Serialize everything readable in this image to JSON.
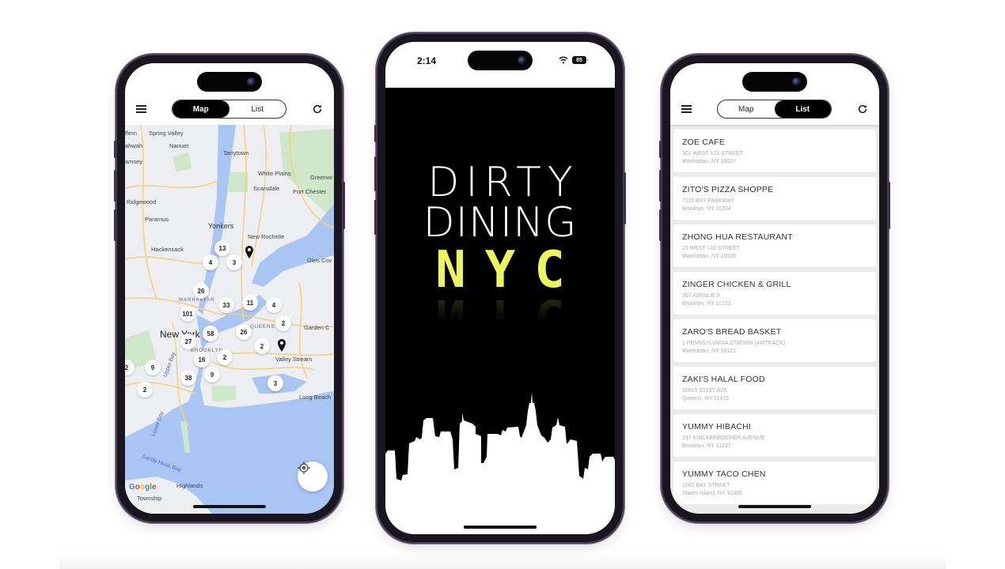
{
  "app": {
    "toggle": {
      "map_label": "Map",
      "list_label": "List"
    }
  },
  "left_phone": {
    "active_tab": "Map",
    "map": {
      "labels": {
        "spring_valley": "Spring Valley",
        "nanuet": "Nanuet",
        "tarrytown": "Tarrytown",
        "white_plains": "White Plains",
        "scarsdale": "Scarsdale",
        "port_chester": "Port Chester",
        "greenwich": "Greenwi",
        "ridgewood": "Ridgewood",
        "paramus": "Paramus",
        "yonkers": "Yonkers",
        "new_rochelle": "New Rochelle",
        "hackensack": "Hackensack",
        "glen_cove": "Glen Cov",
        "manhattan": "MANHATTAN",
        "new_york": "New York",
        "queens": "QUEENS",
        "garden_city": "Garden C",
        "brooklyn": "BROOKLYN",
        "valley_stream": "Valley Stream",
        "long_beach": "Long Beach",
        "upper_bay": "Upper Bay",
        "lower_bay": "Lower Bay",
        "sandy_hook_bay": "Sandy Hook Bay",
        "highlands": "Highlands",
        "township": "Township",
        "mahwah": "ahwah",
        "ramsey": "amsey",
        "suffern": "ffern"
      },
      "clusters": [
        "13",
        "4",
        "3",
        "26",
        "33",
        "11",
        "4",
        "101",
        "2",
        "58",
        "26",
        "27",
        "2",
        "16",
        "2",
        "2",
        "9",
        "9",
        "38",
        "3",
        "2"
      ],
      "pins": 2,
      "google_logo": [
        "G",
        "o",
        "o",
        "g",
        "l",
        "e"
      ]
    }
  },
  "mid_phone": {
    "status": {
      "time": "2:14",
      "battery": "85"
    },
    "logo": {
      "line1": "DIRTY",
      "line2": "DINING",
      "line3": "NYC"
    },
    "accent_color": "#ecf55a"
  },
  "right_phone": {
    "active_tab": "List",
    "restaurants": [
      {
        "name": "ZOE CAFE",
        "street": "301 WEST  121 STREET",
        "city": "Manhattan, NY 10027"
      },
      {
        "name": "ZITO'S PIZZA SHOPPE",
        "street": "7116 BAY PARKWAY",
        "city": "Brooklyn, NY 11204"
      },
      {
        "name": "ZHONG HUA RESTAURANT",
        "street": "23 WEST  100 STREET",
        "city": "Manhattan, NY 10025"
      },
      {
        "name": "ZINGER CHICKEN & GRILL",
        "street": "367 AVENUE X",
        "city": "Brooklyn, NY 11223"
      },
      {
        "name": "ZARO'S BREAD BASKET",
        "street": "1 PENNSYLVANIA STATION (AMTRACK)",
        "city": "Manhattan, NY 10121"
      },
      {
        "name": "ZAKI'S HALAL FOOD",
        "street": "10815 101ST AVE",
        "city": "Queens, NY 11419"
      },
      {
        "name": "YUMMY HIBACHI",
        "street": "197 KNICKERBOCKER AVENUE",
        "city": "Brooklyn, NY 11237"
      },
      {
        "name": "YUMMY TACO CHEN",
        "street": "1082 BAY STREET",
        "city": "Staten Island, NY 10305"
      }
    ]
  }
}
